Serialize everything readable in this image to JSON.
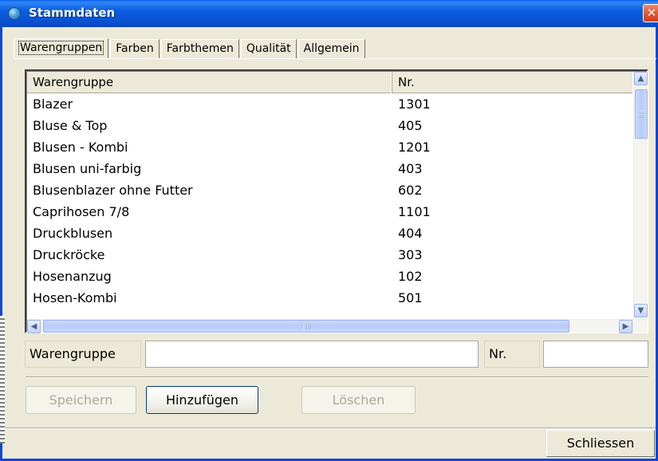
{
  "window": {
    "title": "Stammdaten",
    "close_glyph": "✕",
    "icon": "globe-icon"
  },
  "tabs": [
    {
      "label": "Warengruppen",
      "active": true
    },
    {
      "label": "Farben",
      "active": false
    },
    {
      "label": "Farbthemen",
      "active": false
    },
    {
      "label": "Qualität",
      "active": false
    },
    {
      "label": "Allgemein",
      "active": false
    }
  ],
  "list": {
    "columns": [
      "Warengruppe",
      "Nr."
    ],
    "rows": [
      {
        "name": "Blazer",
        "nr": "1301"
      },
      {
        "name": "Bluse & Top",
        "nr": "405"
      },
      {
        "name": "Blusen - Kombi",
        "nr": "1201"
      },
      {
        "name": "Blusen uni-farbig",
        "nr": "403"
      },
      {
        "name": "Blusenblazer ohne Futter",
        "nr": "602"
      },
      {
        "name": "Caprihosen 7/8",
        "nr": "1101"
      },
      {
        "name": "Druckblusen",
        "nr": "404"
      },
      {
        "name": "Druckröcke",
        "nr": "303"
      },
      {
        "name": "Hosenanzug",
        "nr": "102"
      },
      {
        "name": "Hosen-Kombi",
        "nr": "501"
      }
    ]
  },
  "form": {
    "warengruppe_label": "Warengruppe",
    "warengruppe_value": "",
    "nr_label": "Nr.",
    "nr_value": ""
  },
  "buttons": {
    "save": "Speichern",
    "add": "Hinzufügen",
    "delete": "Löschen",
    "close": "Schliessen"
  },
  "colors": {
    "titlebar": "#0a5ddd",
    "window_bg": "#ece9d8",
    "close_button": "#e05a35",
    "scrollbar": "#c4d5f8"
  }
}
